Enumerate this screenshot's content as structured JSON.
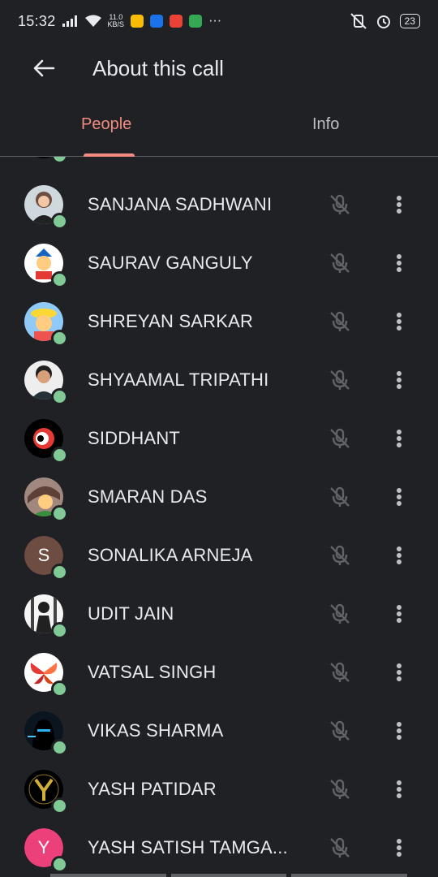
{
  "status_bar": {
    "time": "15:32",
    "speed_value": "11.0",
    "speed_unit": "KB/S",
    "battery": "23",
    "app_colors": [
      "#fbbc04",
      "#1a73e8",
      "#ea4335",
      "#34a853"
    ]
  },
  "header": {
    "title": "About this call",
    "back_icon": "arrow-back-icon"
  },
  "tabs": [
    {
      "label": "People",
      "selected": true
    },
    {
      "label": "Info",
      "selected": false
    }
  ],
  "colors": {
    "background": "#202124",
    "accent": "#f28b82",
    "presence": "#81c995"
  },
  "participants": [
    {
      "name": "SANJANA SADHWANI",
      "avatar": "photo"
    },
    {
      "name": "SAURAV GANGULY",
      "avatar": "photo"
    },
    {
      "name": "SHREYAN SARKAR",
      "avatar": "photo"
    },
    {
      "name": "SHYAAMAL TRIPATHI",
      "avatar": "photo"
    },
    {
      "name": "SIDDHANT",
      "avatar": "photo"
    },
    {
      "name": "SMARAN DAS",
      "avatar": "photo"
    },
    {
      "name": "SONALIKA ARNEJA",
      "avatar_initial": "S",
      "avatar_color": "#6d4c41"
    },
    {
      "name": "UDIT JAIN",
      "avatar": "photo"
    },
    {
      "name": "VATSAL SINGH",
      "avatar": "photo"
    },
    {
      "name": "VIKAS SHARMA",
      "avatar": "photo"
    },
    {
      "name": "YASH PATIDAR",
      "avatar": "photo"
    },
    {
      "name": "YASH SATISH TAMGA...",
      "avatar_initial": "Y",
      "avatar_color": "#ec407a"
    }
  ]
}
